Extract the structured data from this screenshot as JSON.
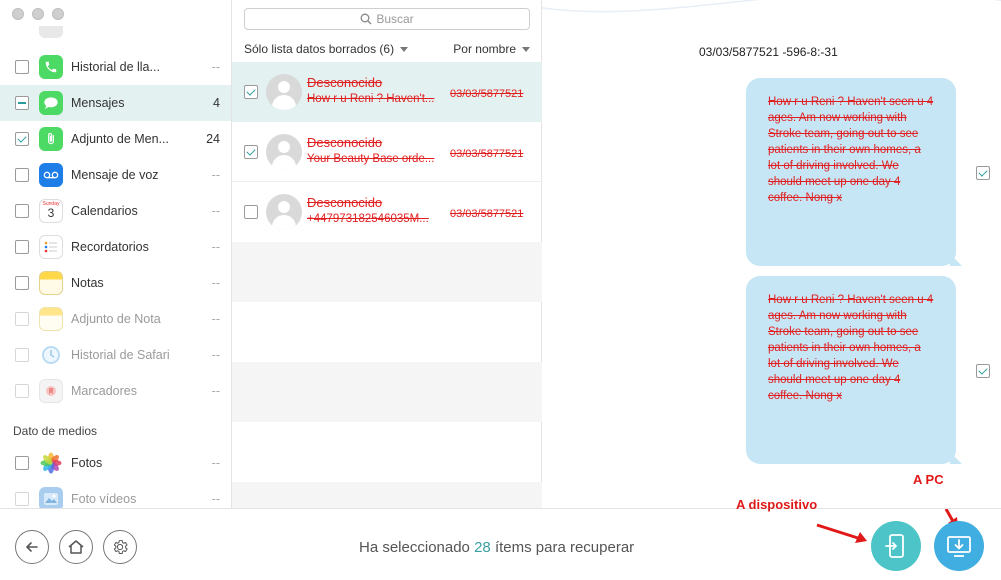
{
  "window": {
    "controls": [
      "close",
      "minimize",
      "zoom"
    ]
  },
  "sidebar": {
    "categories": [
      {
        "label": "Historial de lla...",
        "count": "--",
        "state": "unchecked",
        "dim": false,
        "icon": "phone-icon",
        "color": "#4cd964"
      },
      {
        "label": "Mensajes",
        "count": "4",
        "state": "partial",
        "dim": false,
        "active": true,
        "icon": "messages-icon",
        "color": "#4cd964"
      },
      {
        "label": "Adjunto de Men...",
        "count": "24",
        "state": "checked",
        "dim": false,
        "icon": "attachment-icon",
        "color": "#4cd964"
      },
      {
        "label": "Mensaje de voz",
        "count": "--",
        "state": "unchecked",
        "dim": false,
        "icon": "voicemail-icon",
        "color": "#1e7ee8"
      },
      {
        "label": "Calendarios",
        "count": "--",
        "state": "unchecked",
        "dim": false,
        "icon": "calendar-icon",
        "color": "#ffffff"
      },
      {
        "label": "Recordatorios",
        "count": "--",
        "state": "unchecked",
        "dim": false,
        "icon": "reminders-icon",
        "color": "#ffffff"
      },
      {
        "label": "Notas",
        "count": "--",
        "state": "unchecked",
        "dim": false,
        "icon": "notes-icon",
        "color": "#ffd84a"
      },
      {
        "label": "Adjunto de Nota",
        "count": "--",
        "state": "unchecked",
        "dim": true,
        "icon": "note-attachment-icon",
        "color": "#ffe68a"
      },
      {
        "label": "Historial de Safari",
        "count": "--",
        "state": "unchecked",
        "dim": true,
        "icon": "safari-history-icon",
        "color": "#b9dcf5"
      },
      {
        "label": "Marcadores",
        "count": "--",
        "state": "unchecked",
        "dim": true,
        "icon": "bookmarks-icon",
        "color": "#f2f2f2"
      }
    ],
    "media_section_label": "Dato de medios",
    "media": [
      {
        "label": "Fotos",
        "count": "--",
        "state": "unchecked",
        "dim": false,
        "icon": "photos-icon"
      },
      {
        "label": "Foto vídeos",
        "count": "--",
        "state": "unchecked",
        "dim": true,
        "icon": "photo-videos-icon"
      }
    ]
  },
  "middle": {
    "search_placeholder": "Buscar",
    "filter_label": "Sólo lista datos borrados (6)",
    "sort_label": "Por nombre",
    "messages": [
      {
        "contact": "Desconocido",
        "preview": "How r u Reni ? Haven't...",
        "date": "03/03/5877521",
        "checked": true,
        "selected": true
      },
      {
        "contact": "Desconocido",
        "preview": "Your Beauty Base orde...",
        "date": "03/03/5877521",
        "checked": true,
        "selected": false
      },
      {
        "contact": "Desconocido",
        "preview": "+447973182546035M...",
        "date": "03/03/5877521",
        "checked": false,
        "selected": false
      }
    ]
  },
  "detail": {
    "date": "03/03/5877521 -596-8:-31",
    "bubbles": [
      {
        "text": "How r u Reni ? Haven't seen u 4 ages. Am now working with Stroke team, going out to see patients in their own homes, a lot of driving involved. We should meet up one day 4 coffee. Nong x",
        "checked": true
      },
      {
        "text": "How r u Reni ? Haven't seen u 4 ages. Am now working with Stroke team, going out to see patients in their own homes, a lot of driving involved. We should meet up one day 4 coffee. Nong x",
        "checked": true
      }
    ]
  },
  "bottom": {
    "status_prefix": "Ha seleccionado",
    "status_count": "28",
    "status_suffix": "ítems para recuperar",
    "annotation_device": "A dispositivo",
    "annotation_pc": "A PC"
  },
  "colors": {
    "accent": "#3aa0a0",
    "deleted_text": "#e02020",
    "bubble": "#c6e6f6",
    "selection": "#e3f1f1"
  }
}
